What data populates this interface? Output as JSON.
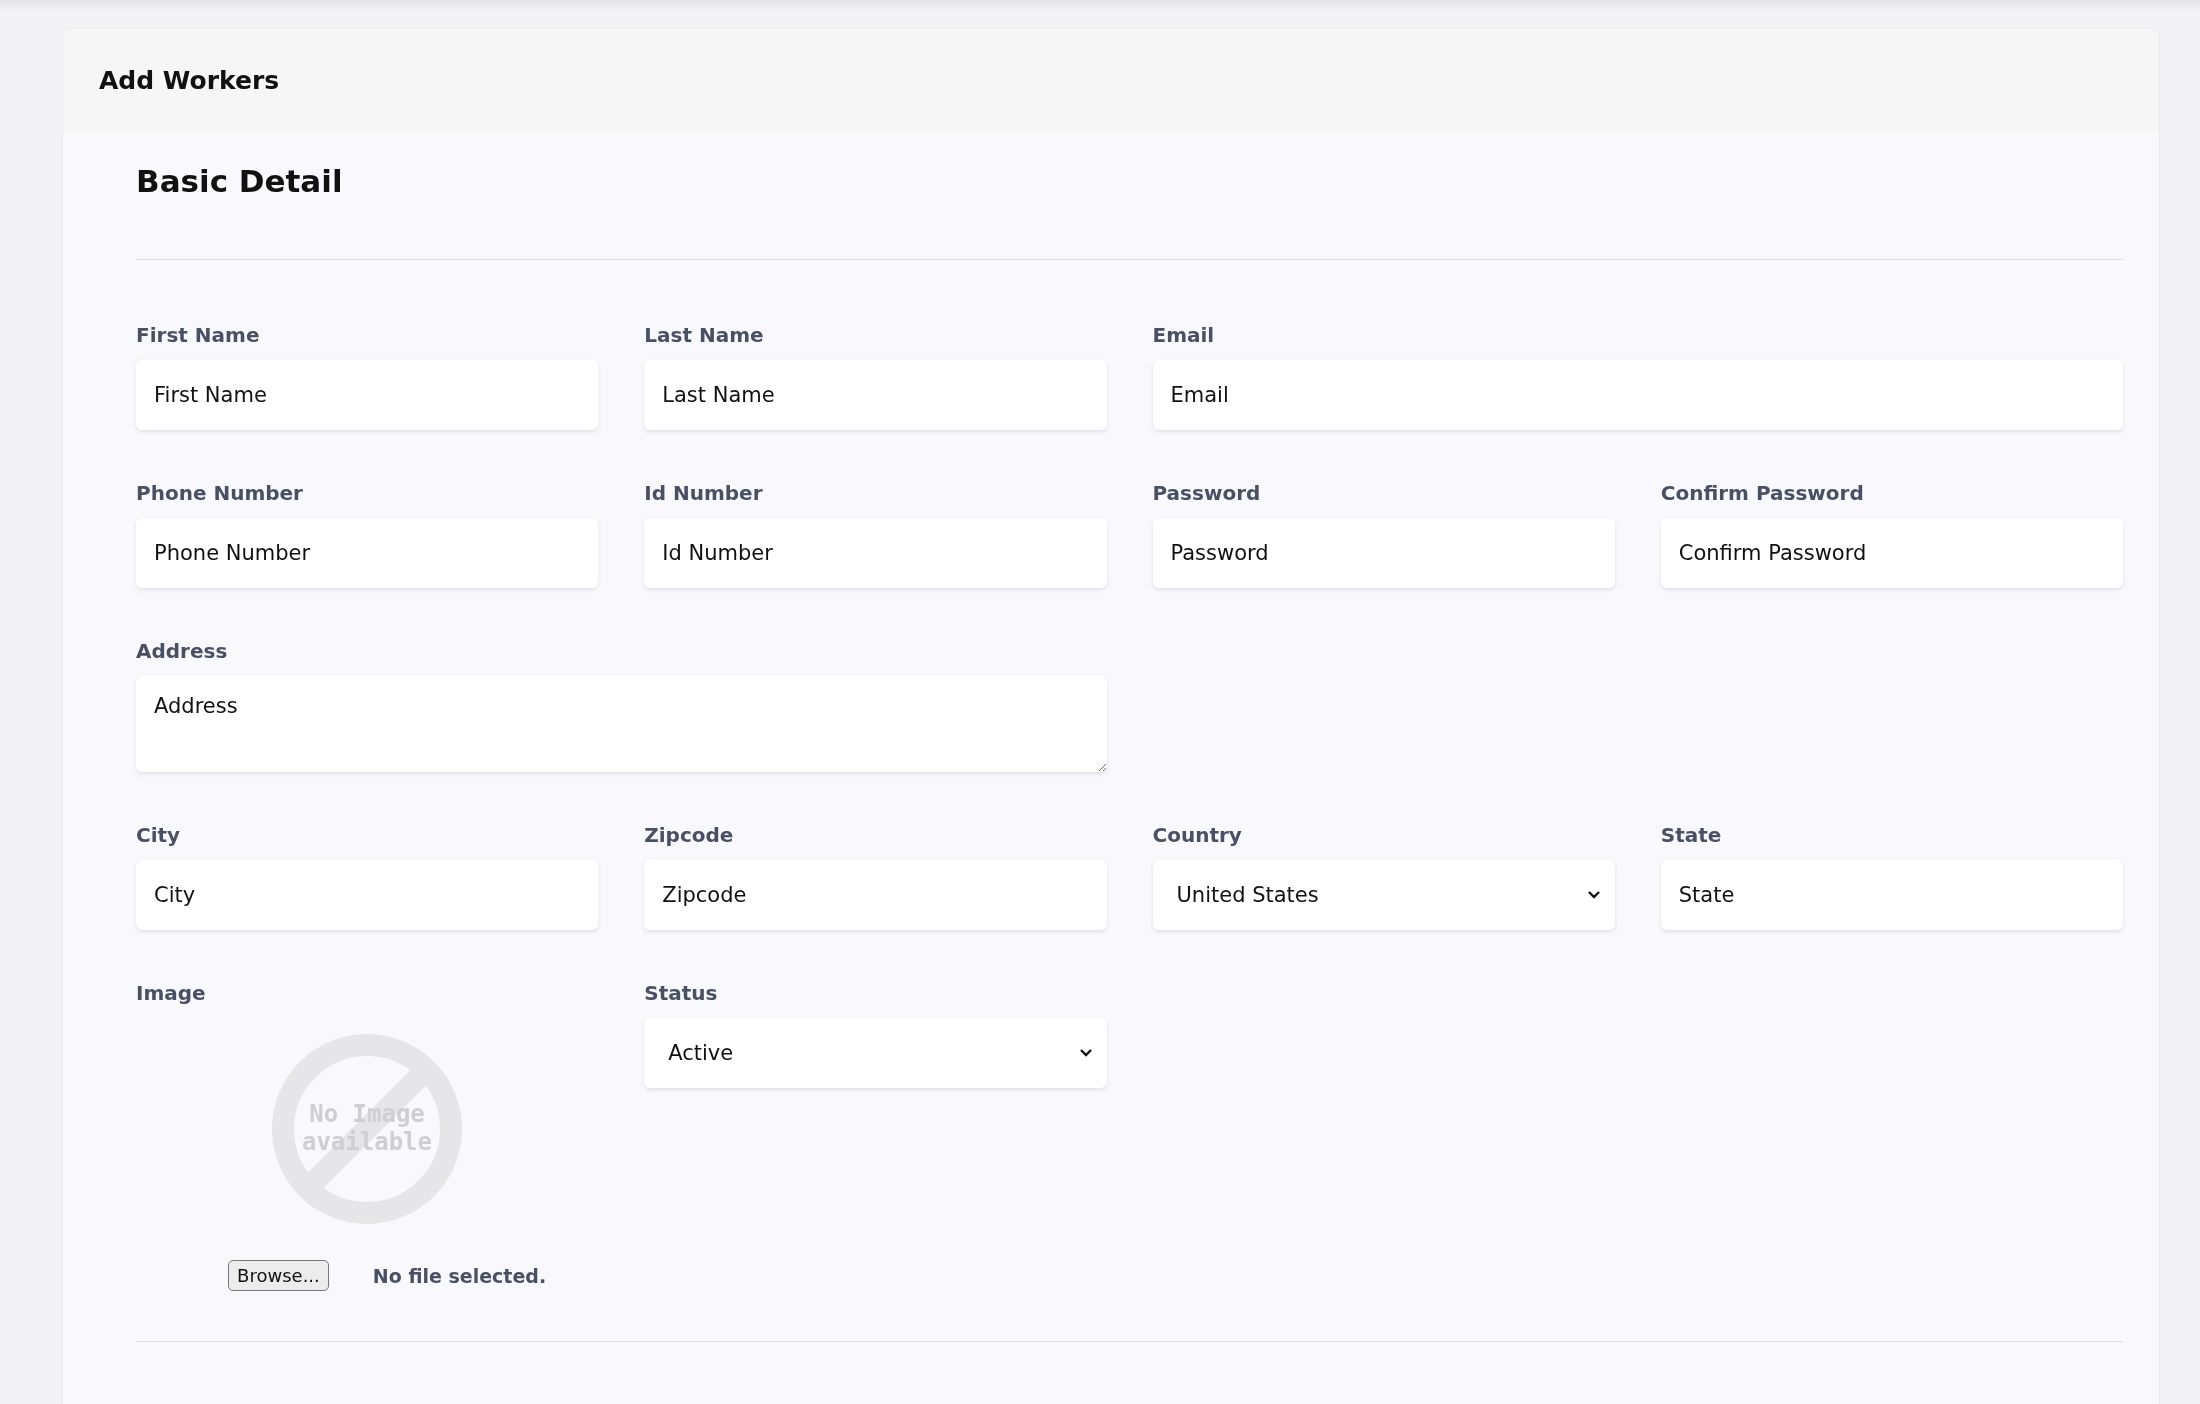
{
  "card": {
    "title": "Add Workers"
  },
  "section": {
    "title": "Basic Detail"
  },
  "rows": [
    [
      {
        "kind": "input",
        "label": "First Name",
        "placeholder": "First Name"
      },
      {
        "kind": "input",
        "label": "Last Name",
        "placeholder": "Last Name"
      },
      {
        "kind": "input",
        "label": "Email",
        "placeholder": "Email"
      }
    ],
    [
      {
        "kind": "input",
        "label": "Phone Number",
        "placeholder": "Phone Number"
      },
      {
        "kind": "input",
        "label": "Id Number",
        "placeholder": "Id Number"
      },
      {
        "kind": "input",
        "label": "Password",
        "placeholder": "Password"
      },
      {
        "kind": "input",
        "label": "Confirm Password",
        "placeholder": "Confirm Password"
      }
    ],
    [
      {
        "kind": "textarea",
        "label": "Address",
        "placeholder": "Address"
      }
    ],
    [
      {
        "kind": "input",
        "label": "City",
        "placeholder": "City"
      },
      {
        "kind": "input",
        "label": "Zipcode",
        "placeholder": "Zipcode"
      },
      {
        "kind": "select",
        "label": "Country",
        "value": "United States"
      },
      {
        "kind": "input",
        "label": "State",
        "placeholder": "State"
      }
    ],
    [
      {
        "kind": "image",
        "label": "Image",
        "image_text": [
          "No Image",
          "available"
        ],
        "button": "Browse...",
        "file_status": "No file selected."
      },
      {
        "kind": "select",
        "label": "Status",
        "value": "Active"
      }
    ]
  ]
}
